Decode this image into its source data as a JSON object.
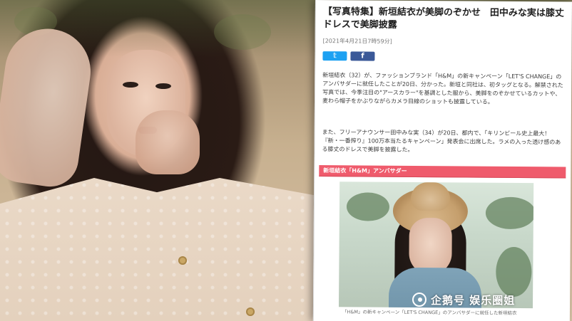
{
  "article": {
    "title": "【写真特集】新垣結衣が美脚のぞかせ　田中みな実は膝丈ドレスで美脚披露",
    "date": "[2021年4月21日7時59分]",
    "share": {
      "twitter_icon": "twitter-icon",
      "facebook_icon": "facebook-icon"
    },
    "paragraph1": "新垣結衣（32）が、ファッションブランド「H&M」の新キャンペーン「LET'S CHANGE」のアンバサダーに就任したことが20日、分かった。新垣と同社は、初タッグとなる。解禁された写真では、今季注目の\"アースカラー\"を基調とした服から、美脚をのぞかせているカットや、麦わら帽子をかぶりながらカメラ目線のショットも披露している。",
    "paragraph2": "また、フリーアナウンサー田中みな実（34）が20日、都内で、「キリンビール史上最大！『新・一番搾り』100万本当たるキャンペーン」発表会に出席した。ラメの入った透け感のある膝丈のドレスで美脚を披露した。",
    "section_heading": "新垣結衣「H&M」アンバサダー",
    "caption": "「H&M」の新キャンペーン「LET'S CHANGE」のアンバサダーに就任した新垣結衣"
  },
  "watermark": {
    "text": "企鹅号 娱乐圈姐",
    "icon": "penguin-logo-icon"
  }
}
